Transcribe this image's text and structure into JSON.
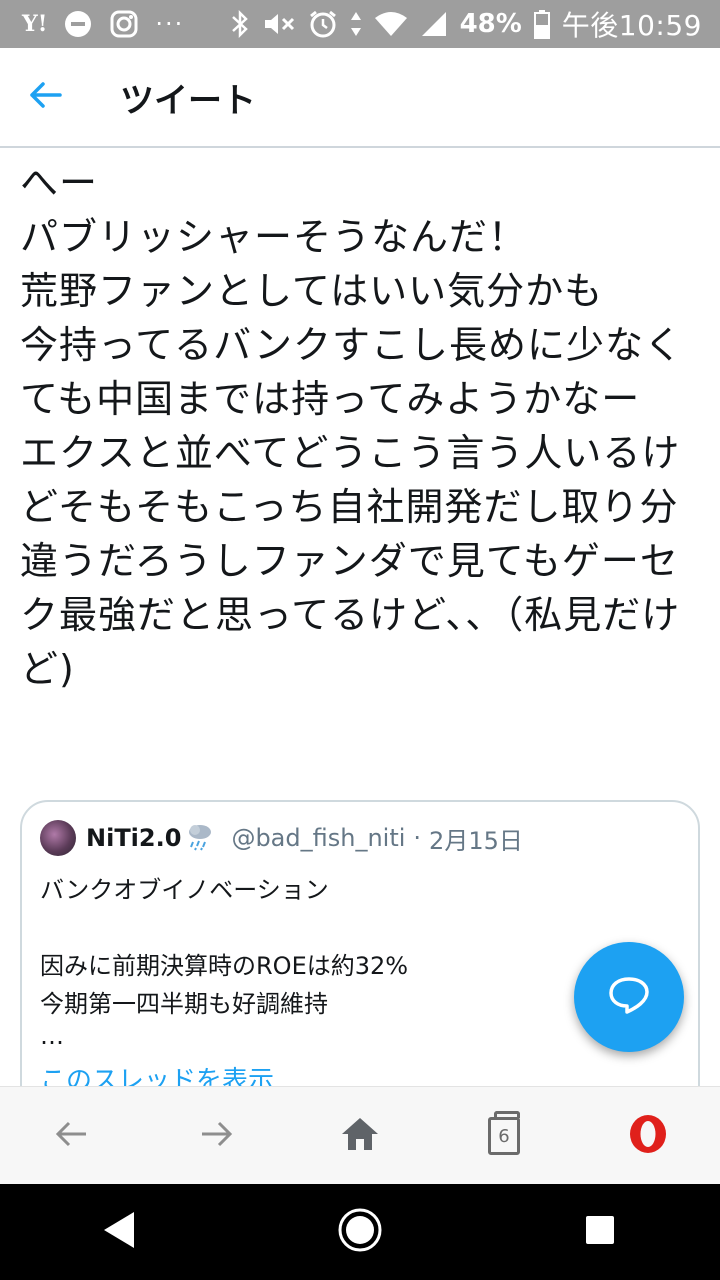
{
  "status_bar": {
    "yahoo_label": "Y!",
    "dots": "···",
    "battery": "48%",
    "time": "午後10:59"
  },
  "header": {
    "title": "ツイート"
  },
  "tweet": {
    "text": "へー\nパブリッシャーそうなんだ！\n荒野ファンとしてはいい気分かも\n今持ってるバンクすこし長めに少なくても中国までは持ってみようかなー\nエクスと並べてどうこう言う人いるけどそもそもこっち自社開発だし取り分違うだろうしファンダで見てもゲーセク最強だと思ってるけど、、（私見だけど)"
  },
  "quote": {
    "name": "NiTi2.0",
    "handle": "@bad_fish_niti",
    "separator": "·",
    "date": "2月15日",
    "lines": [
      "バンクオブイノベーション",
      "因みに前期決算時のROEは約32%",
      "今期第一四半期も好調維持",
      "…"
    ],
    "thread_link": "このスレッドを表示"
  },
  "browser_bar": {
    "tab_count": "6"
  },
  "colors": {
    "accent": "#1da1f2",
    "status_bar": "#9e9e9e",
    "opera_red": "#e0201b"
  },
  "icons": {
    "back": "back-arrow-icon",
    "fab": "speech-bubble-icon",
    "home": "home-icon",
    "opera": "opera-logo-icon"
  }
}
